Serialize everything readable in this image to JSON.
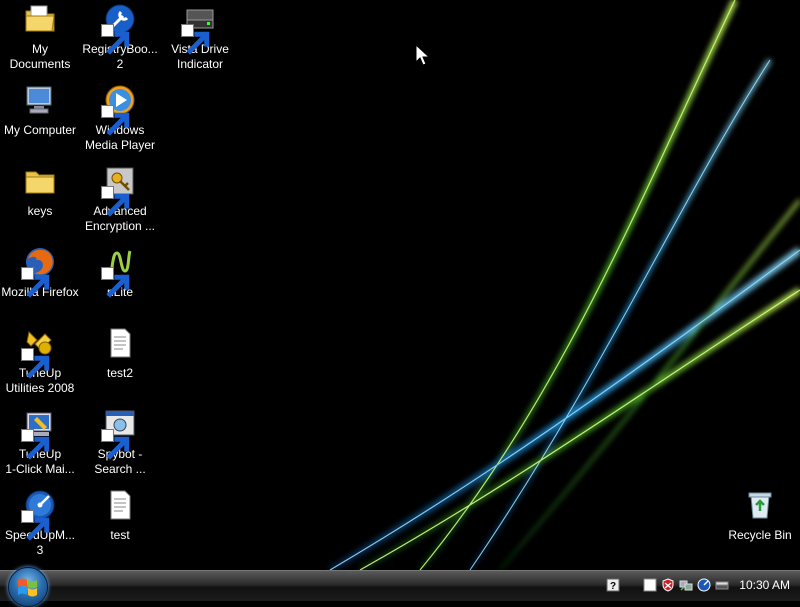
{
  "desktop": {
    "icons": [
      {
        "label": "My\nDocuments",
        "icon": "documents-folder-icon"
      },
      {
        "label": "RegistryBoo...\n2",
        "icon": "registry-booster-icon"
      },
      {
        "label": "Vista Drive\nIndicator",
        "icon": "drive-indicator-icon"
      },
      {
        "label": "My Computer",
        "icon": "computer-icon"
      },
      {
        "label": "Windows\nMedia Player",
        "icon": "media-player-icon"
      },
      {
        "label": "keys",
        "icon": "folder-icon"
      },
      {
        "label": "Advanced\nEncryption ...",
        "icon": "encryption-icon"
      },
      {
        "label": "Mozilla Firefox",
        "icon": "firefox-icon"
      },
      {
        "label": "nLite",
        "icon": "nlite-icon"
      },
      {
        "label": "TuneUp\nUtilities 2008",
        "icon": "tuneup-icon"
      },
      {
        "label": "test2",
        "icon": "text-document-icon"
      },
      {
        "label": "TuneUp\n1-Click Mai...",
        "icon": "tuneup-maintenance-icon"
      },
      {
        "label": "Spybot -\nSearch ...",
        "icon": "spybot-icon"
      },
      {
        "label": "SpeedUpM...\n3",
        "icon": "speedup-icon"
      },
      {
        "label": "test",
        "icon": "text-document-icon"
      },
      {
        "label": "Recycle Bin",
        "icon": "recycle-bin-icon"
      }
    ]
  },
  "taskbar": {
    "start_icon": "windows-logo-icon",
    "tray_icons": [
      "help-icon",
      "white-square-icon",
      "shield-icon",
      "network-icon",
      "speedup-tray-icon",
      "drive-tray-icon"
    ],
    "clock": "10:30 AM"
  },
  "colors": {
    "wallpaper": "#000000",
    "taskbar": "#2b2b2b",
    "accent": "#2a6fb0"
  }
}
